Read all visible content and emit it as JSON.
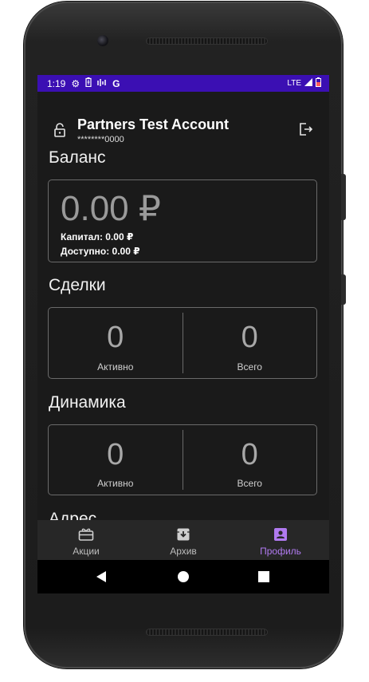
{
  "status": {
    "time": "1:19",
    "network": "LTE"
  },
  "header": {
    "title": "Partners Test Account",
    "account_number": "********0000"
  },
  "balance": {
    "title": "Баланс",
    "amount": "0.00 ₽",
    "capital": "Капитал: 0.00 ₽",
    "available": "Доступно: 0.00 ₽"
  },
  "deals": {
    "title": "Сделки",
    "active_value": "0",
    "active_label": "Активно",
    "total_value": "0",
    "total_label": "Всего"
  },
  "dynamics": {
    "title": "Динамика",
    "active_value": "0",
    "active_label": "Активно",
    "total_value": "0",
    "total_label": "Всего"
  },
  "address": {
    "title": "Адрес"
  },
  "nav": {
    "items": [
      {
        "label": "Акции",
        "icon": "gift-card-icon"
      },
      {
        "label": "Архив",
        "icon": "archive-icon"
      },
      {
        "label": "Профиль",
        "icon": "profile-badge-icon"
      }
    ],
    "active_color": "#b07af0"
  },
  "colors": {
    "statusbar": "#3b0fb3",
    "background": "#1a1a1a",
    "accent": "#b07af0"
  }
}
